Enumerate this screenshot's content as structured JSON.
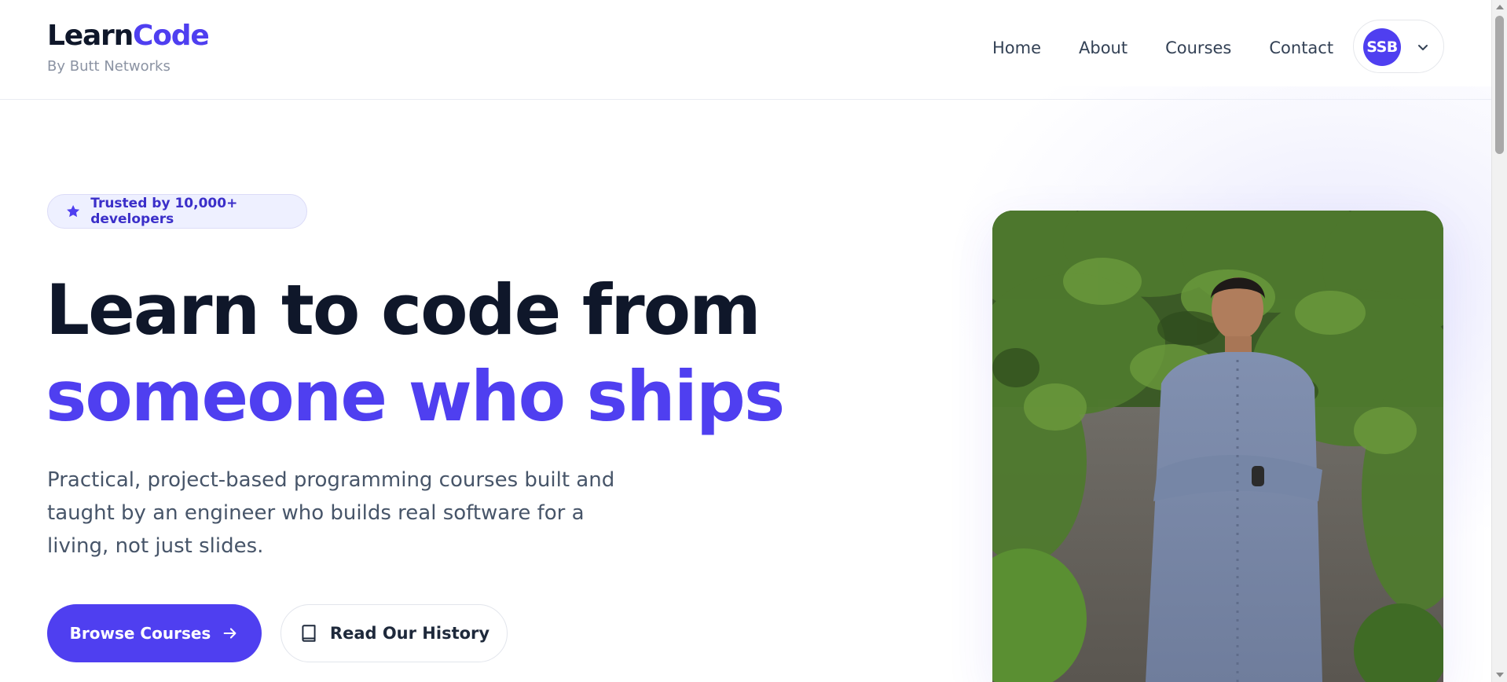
{
  "brand": {
    "name_part1": "Learn",
    "name_part2": "Code",
    "subtitle": "By Butt Networks"
  },
  "nav": {
    "items": [
      {
        "label": "Home"
      },
      {
        "label": "About"
      },
      {
        "label": "Courses"
      },
      {
        "label": "Contact"
      }
    ]
  },
  "user": {
    "initials": "SSB",
    "menu_icon": "chevron-down-icon"
  },
  "hero": {
    "badge": {
      "icon": "star-icon",
      "text": "Trusted by 10,000+ developers"
    },
    "headline_line1": "Learn to code from",
    "headline_line2": "someone who ships",
    "subtitle": "Practical, project-based programming courses built and taught by an engineer who builds real software for a living, not just slides.",
    "primary_button": {
      "label": "Browse Courses",
      "icon": "arrow-right-icon"
    },
    "secondary_button": {
      "label": "Read Our History",
      "icon": "book-icon"
    }
  },
  "colors": {
    "accent": "#4f3ff0",
    "heading": "#0f172a",
    "body_text": "#475569"
  }
}
